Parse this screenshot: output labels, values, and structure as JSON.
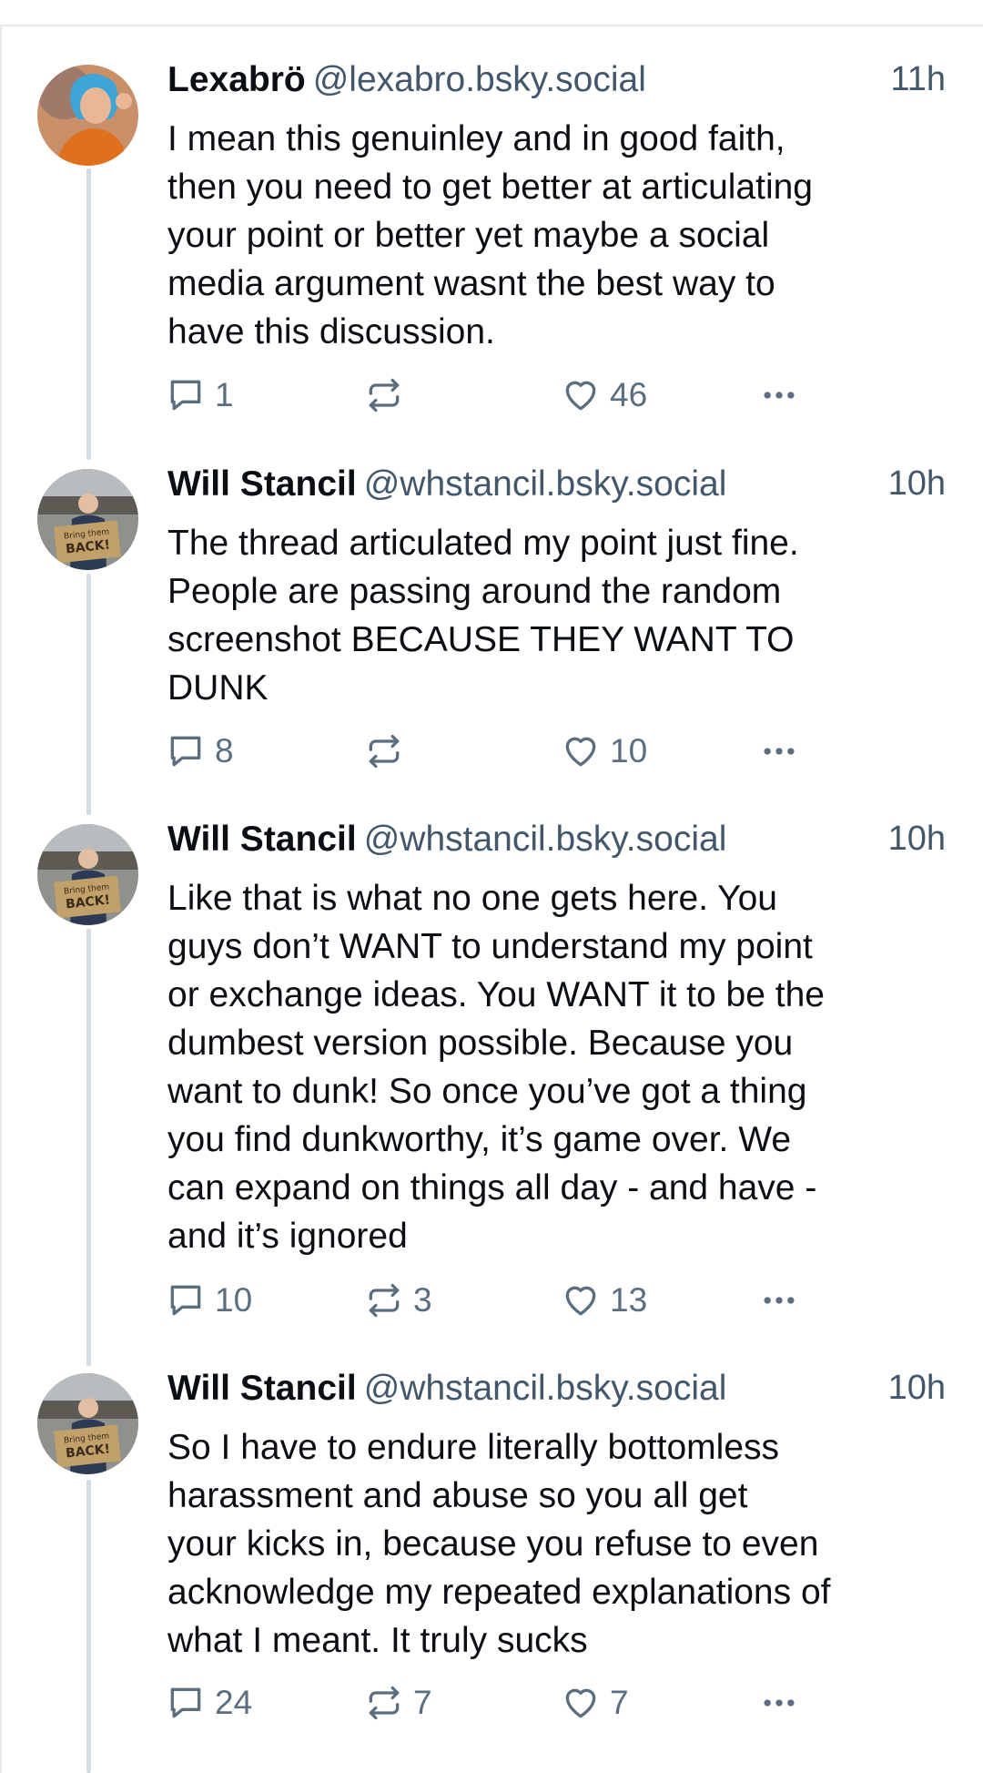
{
  "posts": [
    {
      "name": "Lexabrö",
      "handle": "@lexabro.bsky.social",
      "time": "11h",
      "lines": [
        "I mean this genuinley and in good faith,",
        "then you need to get better at articulating",
        "your point or better yet maybe a social",
        "media argument wasnt the best way to",
        "have this discussion."
      ],
      "replies": "1",
      "reposts": "",
      "likes": "46",
      "avatar": "blue-hair-avatar"
    },
    {
      "name": "Will Stancil",
      "handle": "@whstancil.bsky.social",
      "time": "10h",
      "lines": [
        "The thread articulated my point just fine.",
        "People are passing around the random",
        "screenshot BECAUSE THEY WANT TO",
        "DUNK"
      ],
      "replies": "8",
      "reposts": "",
      "likes": "10",
      "avatar": "protest-sign-avatar"
    },
    {
      "name": "Will Stancil",
      "handle": "@whstancil.bsky.social",
      "time": "10h",
      "lines": [
        "Like that is what no one gets here. You",
        "guys don’t WANT to understand my point",
        "or exchange ideas. You WANT it to be the",
        "dumbest version possible. Because you",
        "want to dunk! So once you’ve got a thing",
        "you find dunkworthy, it’s game over. We",
        "can expand on things all day - and have -",
        "and it’s ignored"
      ],
      "replies": "10",
      "reposts": "3",
      "likes": "13",
      "avatar": "protest-sign-avatar"
    },
    {
      "name": "Will Stancil",
      "handle": "@whstancil.bsky.social",
      "time": "10h",
      "lines": [
        "So I have to endure literally bottomless",
        "harassment and abuse so you all get",
        "your kicks in, because you refuse to even",
        "acknowledge my repeated explanations of",
        "what I meant. It truly sucks"
      ],
      "replies": "24",
      "reposts": "7",
      "likes": "7",
      "avatar": "protest-sign-avatar"
    }
  ],
  "avatar_sign_text": [
    "Bring them",
    "BACK!"
  ],
  "icons": {
    "reply": "reply-icon",
    "repost": "repost-icon",
    "like": "heart-icon",
    "more": "more-dots-icon"
  },
  "colors": {
    "text": "#0b0f14",
    "meta": "#42576c",
    "action": "#5b6e80",
    "thread_line": "#d4dbe2"
  }
}
